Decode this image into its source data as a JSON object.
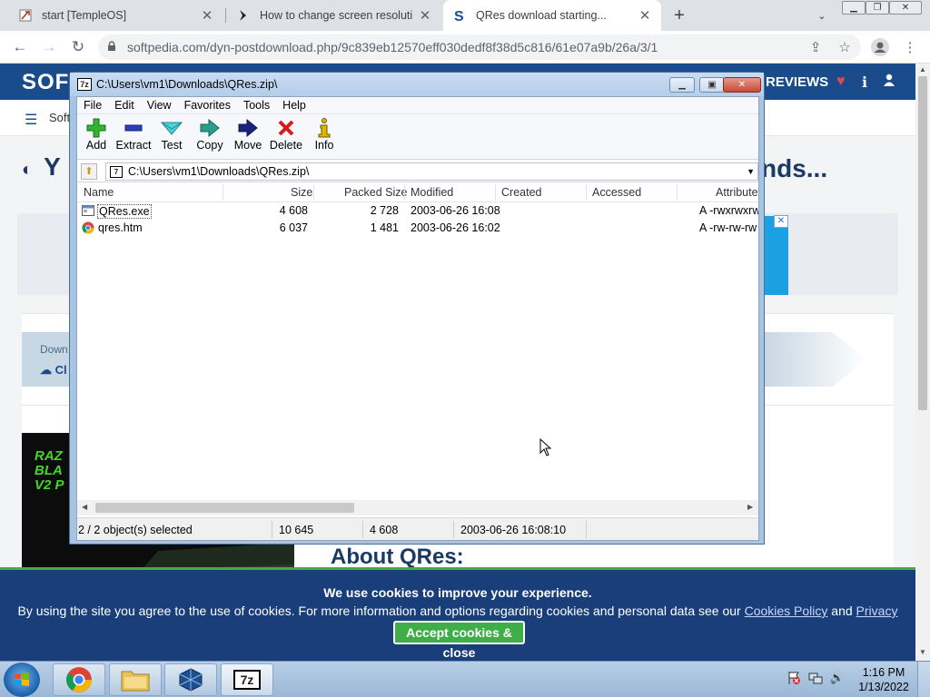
{
  "browser": {
    "tabs": [
      {
        "title": "start [TempleOS]"
      },
      {
        "title": "How to change screen resolutio"
      },
      {
        "title": "QRes download starting..."
      }
    ],
    "url": "softpedia.com/dyn-postdownload.php/9c839eb12570eff030dedf8f38d5c816/61e07a9b/26a/3/1"
  },
  "site": {
    "logo": "SOF",
    "reviews": "REVIEWS",
    "subnav": "Soft",
    "heading_left": "Y",
    "heading_right": "nds...",
    "download_label": "Down",
    "download_btn": "Cl",
    "ad_text": "RAZ\nBLA\nV2 P",
    "about": "About QRes:",
    "cookie_heading": "We use cookies to improve your experience.",
    "cookie_body": "By using the site you agree to the use of cookies. For more information and options regarding cookies and personal data see our",
    "cookie_link1": "Cookies Policy",
    "cookie_and": "and",
    "cookie_link2": "Privacy Policy",
    "cookie_button": "Accept cookies & close"
  },
  "sevenzip": {
    "title": "C:\\Users\\vm1\\Downloads\\QRes.zip\\",
    "menu": [
      "File",
      "Edit",
      "View",
      "Favorites",
      "Tools",
      "Help"
    ],
    "toolbar": [
      {
        "label": "Add",
        "icon": "add-icon"
      },
      {
        "label": "Extract",
        "icon": "extract-icon"
      },
      {
        "label": "Test",
        "icon": "test-icon"
      },
      {
        "label": "Copy",
        "icon": "copy-icon"
      },
      {
        "label": "Move",
        "icon": "move-icon"
      },
      {
        "label": "Delete",
        "icon": "delete-icon"
      },
      {
        "label": "Info",
        "icon": "info-icon"
      }
    ],
    "path": "C:\\Users\\vm1\\Downloads\\QRes.zip\\",
    "columns": [
      "Name",
      "Size",
      "Packed Size",
      "Modified",
      "Created",
      "Accessed",
      "Attribute"
    ],
    "files": [
      {
        "name": "QRes.exe",
        "size": "4 608",
        "packed": "2 728",
        "modified": "2003-06-26 16:08",
        "created": "",
        "accessed": "",
        "attr": "A -rwxrwxrw"
      },
      {
        "name": "qres.htm",
        "size": "6 037",
        "packed": "1 481",
        "modified": "2003-06-26 16:02",
        "created": "",
        "accessed": "",
        "attr": "A -rw-rw-rw"
      }
    ],
    "status": {
      "selected": "2 / 2 object(s) selected",
      "total": "10 645",
      "selsize": "4 608",
      "date": "2003-06-26 16:08:10"
    }
  },
  "taskbar": {
    "time": "1:16 PM",
    "date": "1/13/2022",
    "app_7z": "7z"
  },
  "colors": {
    "softpedia_blue": "#1a4c8b",
    "cookie_green": "#3fae49",
    "chrome_tab_bg": "#dee1e6"
  }
}
